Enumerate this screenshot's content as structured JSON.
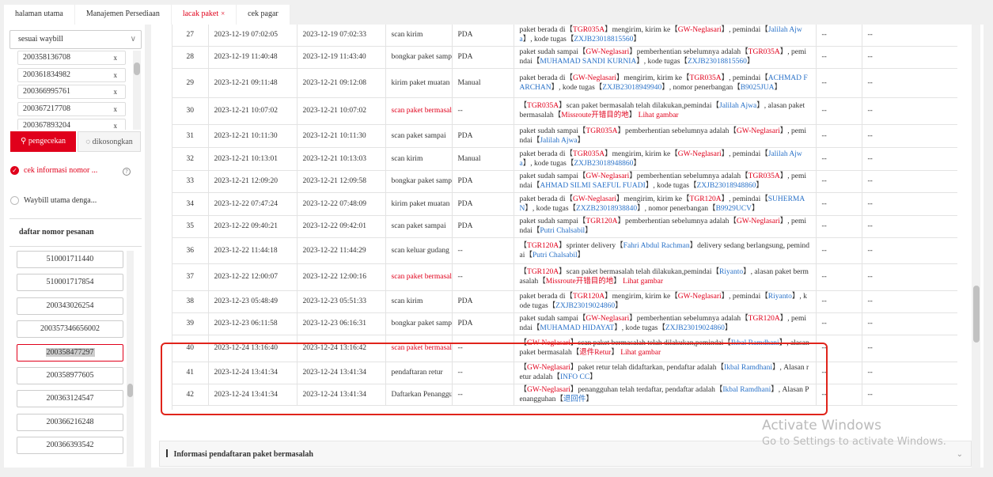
{
  "tabs": [
    {
      "label": "halaman utama"
    },
    {
      "label": "Manajemen Persediaan"
    },
    {
      "label": "lacak paket",
      "close": "×"
    },
    {
      "label": "cek pagar"
    }
  ],
  "left": {
    "select_value": "sesuai waybill",
    "waybills": [
      "200358136708",
      "200361834982",
      "200366995761",
      "200367217708",
      "200367893204"
    ],
    "remove_glyph": "x",
    "check_button": "pengecekan",
    "empty_button": "dikosongkan",
    "option1": "cek informasi nomor ...",
    "option2": "Waybill utama denga...",
    "order_list_title": "daftar nomor pesanan",
    "orders": [
      "510001711440",
      "510001717854",
      "200343026254",
      "200357346656002",
      "200358477297",
      "200358977605",
      "200363124547",
      "200366216248",
      "200366393542"
    ],
    "selected_order": "200358477297"
  },
  "table": {
    "rows": [
      {
        "no": "27",
        "t1": "2023-12-19 07:02:05",
        "t2": "2023-12-19 07:02:33",
        "act": "scan kirim",
        "red": false,
        "dev": "PDA",
        "desc": [
          {
            "t": "paket berada di【"
          },
          {
            "t": "TGR035A",
            "c": "red"
          },
          {
            "t": "】mengirim, kirim ke【"
          },
          {
            "t": "GW-Neglasari",
            "c": "red"
          },
          {
            "t": "】, pemindai【"
          },
          {
            "t": "Jalilah Ajwa",
            "c": "blue"
          },
          {
            "t": "】, kode tugas【"
          },
          {
            "t": "ZXJB23018815560",
            "c": "blue"
          },
          {
            "t": "】"
          }
        ],
        "e1": "--",
        "e2": "--"
      },
      {
        "no": "28",
        "t1": "2023-12-19 11:40:48",
        "t2": "2023-12-19 11:43:40",
        "act": "bongkar paket sampai",
        "red": false,
        "dev": "PDA",
        "desc": [
          {
            "t": "paket sudah sampai【"
          },
          {
            "t": "GW-Neglasari",
            "c": "red"
          },
          {
            "t": "】pemberhentian sebelumnya adalah【"
          },
          {
            "t": "TGR035A",
            "c": "red"
          },
          {
            "t": "】, pemindai【"
          },
          {
            "t": "MUHAMAD SANDI KURNIA",
            "c": "blue"
          },
          {
            "t": "】, kode tugas【"
          },
          {
            "t": "ZXJB23018815560",
            "c": "blue"
          },
          {
            "t": "】"
          }
        ],
        "e1": "--",
        "e2": "--"
      },
      {
        "no": "29",
        "t1": "2023-12-21 09:11:48",
        "t2": "2023-12-21 09:12:08",
        "act": "kirim paket muatan",
        "red": false,
        "dev": "Manual",
        "desc": [
          {
            "t": "paket berada di【"
          },
          {
            "t": "GW-Neglasari",
            "c": "red"
          },
          {
            "t": "】mengirim, kirim ke【"
          },
          {
            "t": "TGR035A",
            "c": "red"
          },
          {
            "t": "】, pemindai【"
          },
          {
            "t": "ACHMAD FARCHAN",
            "c": "blue"
          },
          {
            "t": "】, kode tugas【"
          },
          {
            "t": "ZXJB23018949940",
            "c": "blue"
          },
          {
            "t": "】, nomor penerbangan【"
          },
          {
            "t": "B9025JUA",
            "c": "blue"
          },
          {
            "t": "】"
          }
        ],
        "e1": "--",
        "e2": "--"
      },
      {
        "no": "30",
        "t1": "2023-12-21 10:07:02",
        "t2": "2023-12-21 10:07:02",
        "act": "scan paket bermasalah",
        "red": true,
        "dev": "--",
        "desc": [
          {
            "t": "【"
          },
          {
            "t": "TGR035A",
            "c": "red"
          },
          {
            "t": "】scan paket bermasalah telah dilakukan,pemindai【"
          },
          {
            "t": "Jalilah Ajwa",
            "c": "blue"
          },
          {
            "t": "】, alasan paket bermasalah【"
          },
          {
            "t": "Missroute开错目的地",
            "c": "red"
          },
          {
            "t": "】 "
          },
          {
            "t": "Lihat gambar",
            "c": "red"
          }
        ],
        "e1": "--",
        "e2": "--"
      },
      {
        "no": "31",
        "t1": "2023-12-21 10:11:30",
        "t2": "2023-12-21 10:11:30",
        "act": "scan paket sampai",
        "red": false,
        "dev": "PDA",
        "desc": [
          {
            "t": "paket sudah sampai【"
          },
          {
            "t": "TGR035A",
            "c": "red"
          },
          {
            "t": "】pemberhentian sebelumnya adalah【"
          },
          {
            "t": "GW-Neglasari",
            "c": "red"
          },
          {
            "t": "】, pemindai【"
          },
          {
            "t": "Jalilah Ajwa",
            "c": "blue"
          },
          {
            "t": "】"
          }
        ],
        "e1": "--",
        "e2": "--"
      },
      {
        "no": "32",
        "t1": "2023-12-21 10:13:01",
        "t2": "2023-12-21 10:13:03",
        "act": "scan kirim",
        "red": false,
        "dev": "Manual",
        "desc": [
          {
            "t": "paket berada di【"
          },
          {
            "t": "TGR035A",
            "c": "red"
          },
          {
            "t": "】mengirim, kirim ke【"
          },
          {
            "t": "GW-Neglasari",
            "c": "red"
          },
          {
            "t": "】, pemindai【"
          },
          {
            "t": "Jalilah Ajwa",
            "c": "blue"
          },
          {
            "t": "】, kode tugas【"
          },
          {
            "t": "ZXJB23018948860",
            "c": "blue"
          },
          {
            "t": "】"
          }
        ],
        "e1": "--",
        "e2": "--"
      },
      {
        "no": "33",
        "t1": "2023-12-21 12:09:20",
        "t2": "2023-12-21 12:09:58",
        "act": "bongkar paket sampai",
        "red": false,
        "dev": "PDA",
        "desc": [
          {
            "t": "paket sudah sampai【"
          },
          {
            "t": "GW-Neglasari",
            "c": "red"
          },
          {
            "t": "】pemberhentian sebelumnya adalah【"
          },
          {
            "t": "TGR035A",
            "c": "red"
          },
          {
            "t": "】, pemindai【"
          },
          {
            "t": "AHMAD SILMI SAEFUL FUADI",
            "c": "blue"
          },
          {
            "t": "】, kode tugas【"
          },
          {
            "t": "ZXJB23018948860",
            "c": "blue"
          },
          {
            "t": "】"
          }
        ],
        "e1": "--",
        "e2": "--"
      },
      {
        "no": "34",
        "t1": "2023-12-22 07:47:24",
        "t2": "2023-12-22 07:48:09",
        "act": "kirim paket muatan",
        "red": false,
        "dev": "PDA",
        "desc": [
          {
            "t": "paket berada di【"
          },
          {
            "t": "GW-Neglasari",
            "c": "red"
          },
          {
            "t": "】mengirim, kirim ke【"
          },
          {
            "t": "TGR120A",
            "c": "red"
          },
          {
            "t": "】, pemindai【"
          },
          {
            "t": "SUHERMAN",
            "c": "blue"
          },
          {
            "t": "】, kode tugas【"
          },
          {
            "t": "ZXZB23018938840",
            "c": "blue"
          },
          {
            "t": "】, nomor penerbangan【"
          },
          {
            "t": "B9929UCV",
            "c": "blue"
          },
          {
            "t": "】"
          }
        ],
        "e1": "--",
        "e2": "--"
      },
      {
        "no": "35",
        "t1": "2023-12-22 09:40:21",
        "t2": "2023-12-22 09:42:01",
        "act": "scan paket sampai",
        "red": false,
        "dev": "PDA",
        "desc": [
          {
            "t": "paket sudah sampai【"
          },
          {
            "t": "TGR120A",
            "c": "red"
          },
          {
            "t": "】pemberhentian sebelumnya adalah【"
          },
          {
            "t": "GW-Neglasari",
            "c": "red"
          },
          {
            "t": "】, pemindai【"
          },
          {
            "t": "Putri Chalsabil",
            "c": "blue"
          },
          {
            "t": "】"
          }
        ],
        "e1": "--",
        "e2": "--"
      },
      {
        "no": "36",
        "t1": "2023-12-22 11:44:18",
        "t2": "2023-12-22 11:44:29",
        "act": "scan keluar gudang",
        "red": false,
        "dev": "--",
        "desc": [
          {
            "t": "【"
          },
          {
            "t": "TGR120A",
            "c": "red"
          },
          {
            "t": "】sprinter delivery【"
          },
          {
            "t": "Fahri Abdul Rachman",
            "c": "blue"
          },
          {
            "t": "】delivery sedang berlangsung, pemindai【"
          },
          {
            "t": "Putri Chalsabil",
            "c": "blue"
          },
          {
            "t": "】"
          }
        ],
        "e1": "--",
        "e2": "--"
      },
      {
        "no": "37",
        "t1": "2023-12-22 12:00:07",
        "t2": "2023-12-22 12:00:16",
        "act": "scan paket bermasalah",
        "red": true,
        "dev": "--",
        "desc": [
          {
            "t": "【"
          },
          {
            "t": "TGR120A",
            "c": "red"
          },
          {
            "t": "】scan paket bermasalah telah dilakukan,pemindai【"
          },
          {
            "t": "Riyanto",
            "c": "blue"
          },
          {
            "t": "】, alasan paket bermasalah【"
          },
          {
            "t": "Missroute开错目的地",
            "c": "red"
          },
          {
            "t": "】 "
          },
          {
            "t": "Lihat gambar",
            "c": "red"
          }
        ],
        "e1": "--",
        "e2": "--"
      },
      {
        "no": "38",
        "t1": "2023-12-23 05:48:49",
        "t2": "2023-12-23 05:51:33",
        "act": "scan kirim",
        "red": false,
        "dev": "PDA",
        "desc": [
          {
            "t": "paket berada di【"
          },
          {
            "t": "TGR120A",
            "c": "red"
          },
          {
            "t": "】mengirim, kirim ke【"
          },
          {
            "t": "GW-Neglasari",
            "c": "red"
          },
          {
            "t": "】, pemindai【"
          },
          {
            "t": "Riyanto",
            "c": "blue"
          },
          {
            "t": "】, kode tugas【"
          },
          {
            "t": "ZXJB23019024860",
            "c": "blue"
          },
          {
            "t": "】"
          }
        ],
        "e1": "--",
        "e2": "--"
      },
      {
        "no": "39",
        "t1": "2023-12-23 06:11:58",
        "t2": "2023-12-23 06:16:31",
        "act": "bongkar paket sampai",
        "red": false,
        "dev": "PDA",
        "desc": [
          {
            "t": "paket sudah sampai【"
          },
          {
            "t": "GW-Neglasari",
            "c": "red"
          },
          {
            "t": "】pemberhentian sebelumnya adalah【"
          },
          {
            "t": "TGR120A",
            "c": "red"
          },
          {
            "t": "】, pemindai【"
          },
          {
            "t": "MUHAMAD HIDAYAT",
            "c": "blue"
          },
          {
            "t": "】, kode tugas【"
          },
          {
            "t": "ZXJB23019024860",
            "c": "blue"
          },
          {
            "t": "】"
          }
        ],
        "e1": "--",
        "e2": "--"
      },
      {
        "no": "40",
        "t1": "2023-12-24 13:16:40",
        "t2": "2023-12-24 13:16:42",
        "act": "scan paket bermasalah",
        "red": true,
        "dev": "--",
        "desc": [
          {
            "t": "【"
          },
          {
            "t": "GW-Neglasari",
            "c": "red"
          },
          {
            "t": "】scan paket bermasalah telah dilakukan,pemindai【"
          },
          {
            "t": "Ikbal Ramdhani",
            "c": "blue"
          },
          {
            "t": "】, alasan paket bermasalah【"
          },
          {
            "t": "退件Retur",
            "c": "red"
          },
          {
            "t": "】 "
          },
          {
            "t": "Lihat gambar",
            "c": "red"
          }
        ],
        "e1": "--",
        "e2": "--"
      },
      {
        "no": "41",
        "t1": "2023-12-24 13:41:34",
        "t2": "2023-12-24 13:41:34",
        "act": "pendaftaran retur",
        "red": false,
        "dev": "--",
        "desc": [
          {
            "t": "【"
          },
          {
            "t": "GW-Neglasari",
            "c": "red"
          },
          {
            "t": "】paket retur telah didaftarkan, pendaftar adalah【"
          },
          {
            "t": "Ikbal Ramdhani",
            "c": "blue"
          },
          {
            "t": "】, Alasan retur adalah【"
          },
          {
            "t": "INFO CC",
            "c": "blue"
          },
          {
            "t": "】"
          }
        ],
        "e1": "--",
        "e2": "--"
      },
      {
        "no": "42",
        "t1": "2023-12-24 13:41:34",
        "t2": "2023-12-24 13:41:34",
        "act": "Daftarkan Penangguhan",
        "red": false,
        "dev": "--",
        "desc": [
          {
            "t": "【"
          },
          {
            "t": "GW-Neglasari",
            "c": "red"
          },
          {
            "t": "】penangguhan telah terdaftar, pendaftar adalah【"
          },
          {
            "t": "Ikbal Ramdhani",
            "c": "blue"
          },
          {
            "t": "】, Alasan Penangguhan【"
          },
          {
            "t": "退回件",
            "c": "blue"
          },
          {
            "t": "】"
          }
        ],
        "e1": "--",
        "e2": "--"
      }
    ]
  },
  "info_section": {
    "title": "Informasi pendaftaran paket bermasalah",
    "chevron": "⌄"
  },
  "watermark": {
    "line1": "Activate Windows",
    "line2": "Go to Settings to activate Windows."
  },
  "colors": {
    "accent": "#e0001b",
    "link": "#2a72c8",
    "highlight_box": "#e0241b"
  }
}
